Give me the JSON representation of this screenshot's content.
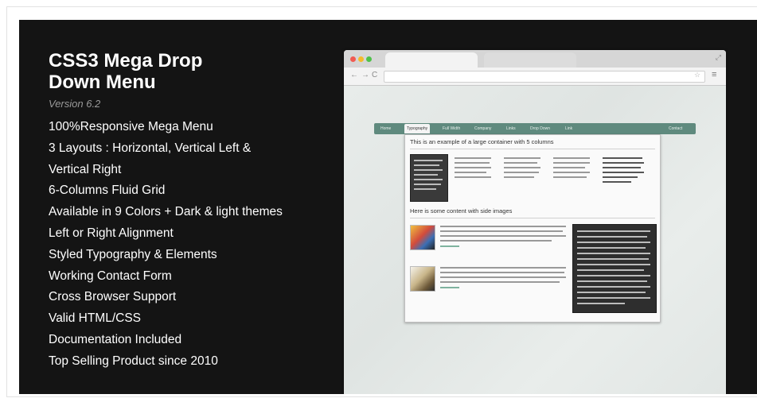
{
  "product": {
    "title_line1": "CSS3 Mega Drop",
    "title_line2": "Down Menu",
    "version": "Version 6.2"
  },
  "features": [
    "100%Responsive Mega Menu",
    "3 Layouts : Horizontal, Vertical Left &",
    "Vertical Right",
    "6-Columns Fluid Grid",
    "Available in 9 Colors + Dark & light themes",
    "Left or Right Alignment",
    "Styled Typography & Elements",
    "Working Contact Form",
    "Cross Browser Support",
    "Valid HTML/CSS",
    "Documentation Included",
    "Top Selling Product since 2010"
  ],
  "preview": {
    "nav_buttons": [
      "←",
      "→",
      "C"
    ],
    "menu_items": [
      "Home",
      "Typography",
      "Full Width",
      "Company",
      "Links",
      "Drop Down",
      "Link",
      "Contact"
    ],
    "active_menu_item": "Typography",
    "heading_1": "This is an example of a large container with 5 columns",
    "heading_2": "Here is some content with side images",
    "colors": {
      "banner_background": "#141414",
      "menu_bar": "#5f8a7e",
      "panel_background": "#fafafa"
    }
  }
}
